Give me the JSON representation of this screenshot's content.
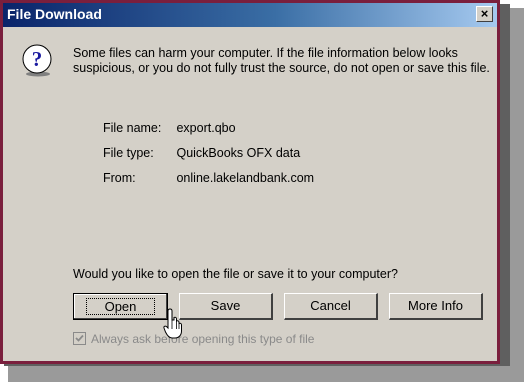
{
  "dialog": {
    "title": "File Download",
    "close_label": "×",
    "warning": "Some files can harm your computer. If the file information below looks suspicious, or you do not fully trust the source, do not open or save this file.",
    "file_name_label": "File name:",
    "file_name": "export.qbo",
    "file_type_label": "File type:",
    "file_type": "QuickBooks OFX data",
    "from_label": "From:",
    "from": "online.lakelandbank.com",
    "question": "Would you like to open the file or save it to your computer?",
    "buttons": {
      "open": "Open",
      "save": "Save",
      "cancel": "Cancel",
      "more_info": "More Info"
    },
    "checkbox_label": "Always ask before opening this type of file",
    "checkbox_checked": true
  },
  "colors": {
    "title_bar": "#0a246a",
    "frame": "#7a1f3d",
    "dialog_bg": "#d4d0c8"
  },
  "icons": [
    "question-icon",
    "close-icon",
    "mouse-cursor-icon",
    "checkmark-icon"
  ]
}
